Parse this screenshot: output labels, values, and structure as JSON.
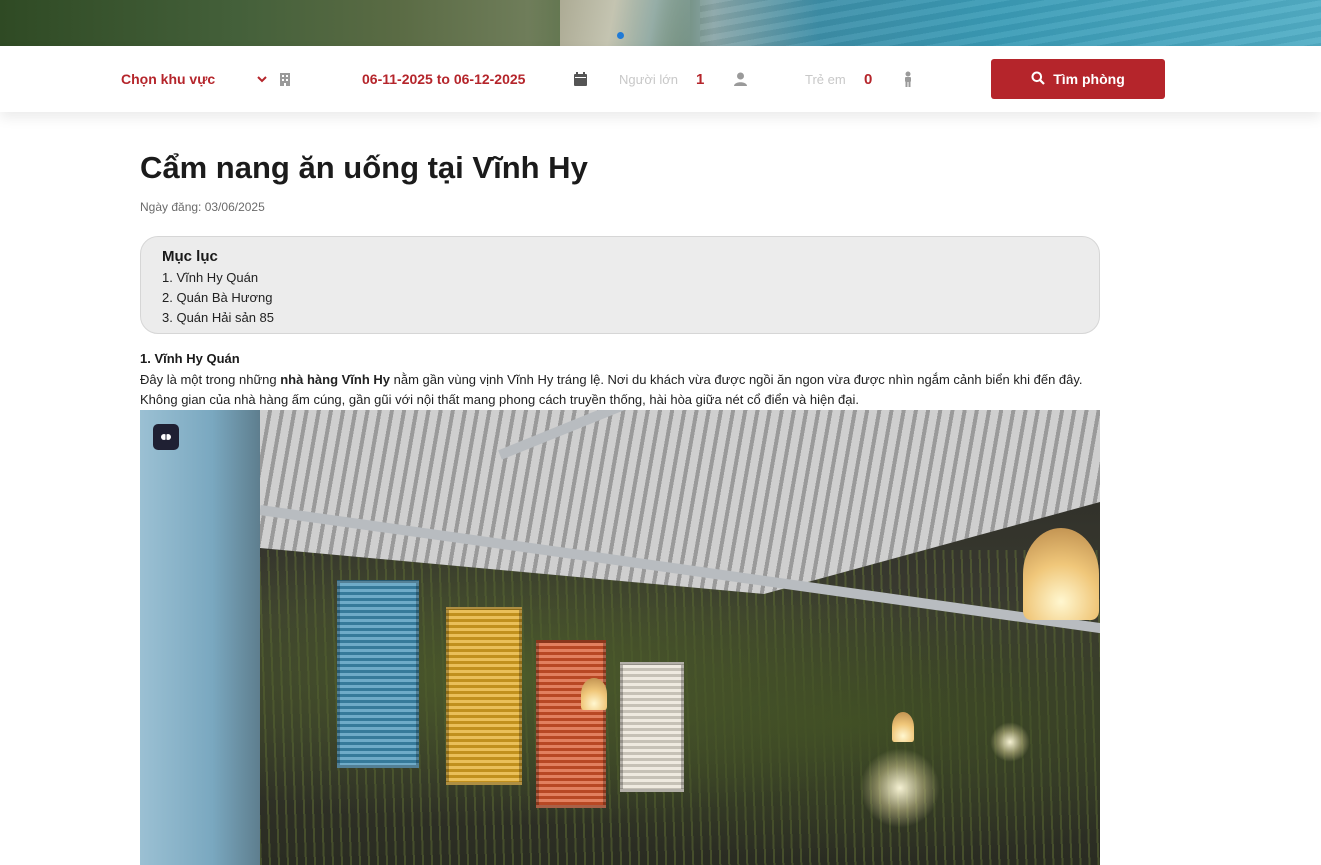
{
  "search": {
    "area_label": "Chọn khu vực",
    "date_range": "06-11-2025 to 06-12-2025",
    "adults_label": "Người lớn",
    "adults_value": "1",
    "children_label": "Trẻ em",
    "children_value": "0",
    "button_label": "Tìm phòng"
  },
  "article": {
    "title": "Cẩm nang ăn uống tại Vĩnh Hy",
    "date": "Ngày đăng: 03/06/2025",
    "toc": {
      "heading": "Mục lục",
      "items": [
        "1. Vĩnh Hy Quán",
        "2. Quán Bà Hương",
        "3. Quán Hải sản 85"
      ]
    },
    "section1": {
      "heading": "1. Vĩnh Hy Quán",
      "para_pre": "Đây là một trong những ",
      "para_bold": "nhà hàng Vĩnh Hy",
      "para_post": " nằm gần vùng vịnh Vĩnh Hy tráng lệ. Nơi du khách vừa được ngồi ăn ngon vừa được nhìn ngắm cảnh biển khi đến đây. Không gian của nhà hàng ấm cúng, gần gũi với nội thất mang phong cách truyền thống, hài hòa giữa nét cổ điển và hiện đại."
    }
  },
  "icons": {
    "area_dropdown": "chevron-down-icon",
    "area_building": "building-icon",
    "date": "calendar-icon",
    "adults": "user-icon",
    "children": "child-icon",
    "search_button": "search-icon",
    "photo_badge": "ai-badge-icon"
  },
  "colors": {
    "accent": "#b5252b",
    "toc_bg": "#ececec"
  }
}
